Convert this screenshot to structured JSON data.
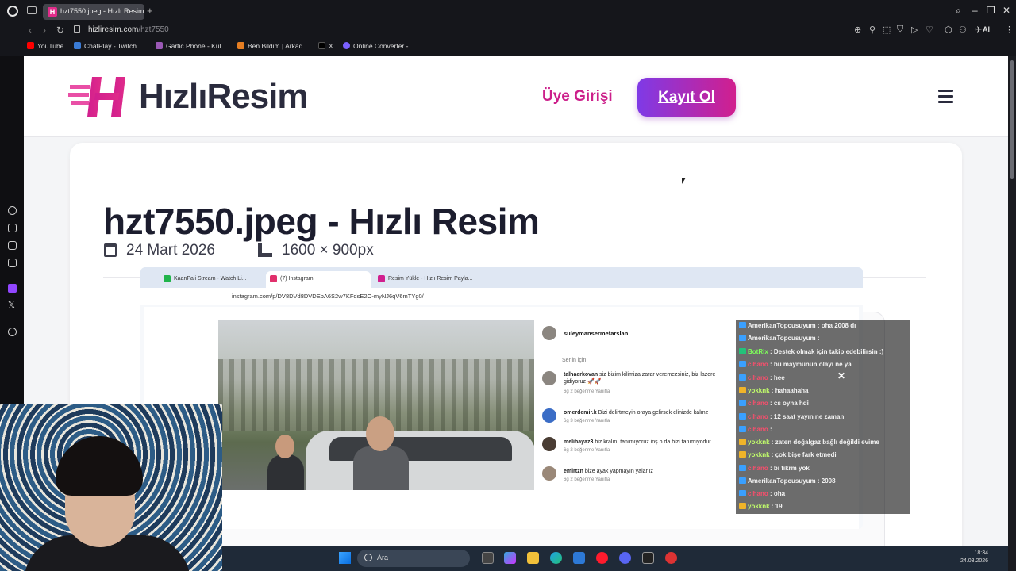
{
  "browser": {
    "tab_title": "hzt7550.jpeg - Hızlı Resim",
    "url_host": "hizliresim.com",
    "url_path": "/hzt7550",
    "ai_label": "AI",
    "bookmarks": [
      {
        "label": "YouTube",
        "color": "#ff0000"
      },
      {
        "label": "ChatPlay - Twitch...",
        "color": "#3a7bd5"
      },
      {
        "label": "Gartic Phone - Kul...",
        "color": "#9b59b6"
      },
      {
        "label": "Ben Bildim | Arkad...",
        "color": "#e67e22"
      },
      {
        "label": "X",
        "color": "#000000"
      },
      {
        "label": "Online Converter -...",
        "color": "#7b61ff"
      }
    ]
  },
  "site": {
    "logo_text": "HızlıResim",
    "login_label": "Üye Girişi",
    "signup_label": "Kayıt Ol",
    "brand_color": "#d11f8e",
    "accent_color": "#7f3ae6"
  },
  "image_page": {
    "title": "hzt7550.jpeg - Hızlı Resim",
    "date": "24 Mart 2026",
    "dimensions": "1600 × 900px"
  },
  "embedded_screenshot": {
    "tabs": [
      {
        "label": "KaanPaii Stream - Watch Li...",
        "color": "#21b44b"
      },
      {
        "label": "(7) Instagram",
        "color": "#e1306c"
      },
      {
        "label": "Resim Yükle - Hızlı Resim Payla...",
        "color": "#d11f8e"
      }
    ],
    "url": "instagram.com/p/DV8DVd8DVDEbA6S2w7KFdsE2O-myNJ6qV6mTYg0/",
    "post_user": "suleymansermetarslan",
    "for_you": "Senin için",
    "comments": [
      {
        "user": "talhaerkovan",
        "text": "siz bizim kilimiza zarar veremezsiniz, biz lazere gidiyoruz 🚀🚀",
        "meta": "6g    2 beğenme    Yanıtla"
      },
      {
        "user": "omerdemir.k",
        "text": "Bizi delirtmeyin oraya gelirsek elinizde kalınz",
        "meta": "6g    3 beğenme    Yanıtla"
      },
      {
        "user": "melihayaz3",
        "text": "biz kralını tanımıyoruz inş o da bizi tanımıyodur",
        "meta": "6g    2 beğenme    Yanıtla"
      },
      {
        "user": "emirtzn",
        "text": "bize ayak yapmayın yalanız",
        "meta": "6g    2 beğenme    Yanıtla"
      }
    ]
  },
  "chat": [
    {
      "user": "AmerikanTopcusuyum",
      "msg": "oha 2008 dı",
      "color": "#f3f3f3"
    },
    {
      "user": "AmerikanTopcusuyum",
      "msg": "",
      "color": "#f3f3f3"
    },
    {
      "user": "BotRix",
      "msg": "Destek olmak için takip edebilirsin :)",
      "color": "#7dff5a"
    },
    {
      "user": "cihano",
      "msg": "bu maymunun olayı ne ya",
      "color": "#ff4d6d"
    },
    {
      "user": "cihano",
      "msg": "hee",
      "color": "#ff4d6d"
    },
    {
      "user": "yokknk",
      "msg": "hahaahaha",
      "color": "#c3ff6b"
    },
    {
      "user": "cihano",
      "msg": "cs oyna hdi",
      "color": "#ff4d6d"
    },
    {
      "user": "cihano",
      "msg": "12 saat yayın ne zaman",
      "color": "#ff4d6d"
    },
    {
      "user": "cihano",
      "msg": "",
      "color": "#ff4d6d"
    },
    {
      "user": "yokknk",
      "msg": "zaten doğalgaz bağlı değildi evime",
      "color": "#c3ff6b"
    },
    {
      "user": "yokknk",
      "msg": "çok bişe fark etmedi",
      "color": "#c3ff6b"
    },
    {
      "user": "cihano",
      "msg": "bi fikrm yok",
      "color": "#ff4d6d"
    },
    {
      "user": "AmerikanTopcusuyum",
      "msg": "2008",
      "color": "#f3f3f3"
    },
    {
      "user": "cihano",
      "msg": "oha",
      "color": "#ff4d6d"
    },
    {
      "user": "yokknk",
      "msg": "19",
      "color": "#c3ff6b"
    }
  ],
  "taskbar": {
    "search_label": "Ara",
    "time": "18:34",
    "date": "24.03.2026"
  }
}
